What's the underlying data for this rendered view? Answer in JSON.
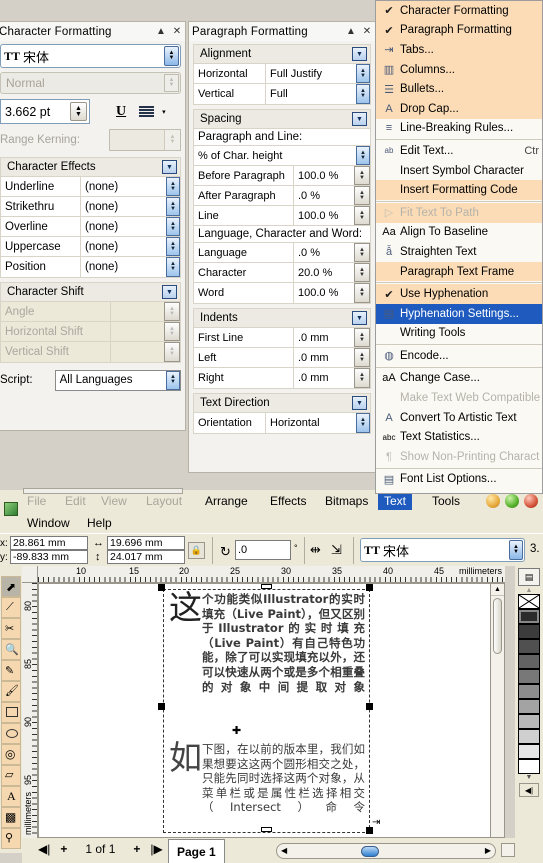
{
  "character_docker": {
    "title": "Character Formatting",
    "collapse_icon": "▲",
    "close_icon": "✕",
    "font": {
      "name": "宋体",
      "icon": "TT"
    },
    "style": {
      "value": "Normal"
    },
    "size": {
      "value": "3.662 pt"
    },
    "underline_icon": "U",
    "align_icon": "align-lines-icon",
    "dropdown_icon": "▾",
    "kerning": {
      "label": "Range Kerning:",
      "value": ""
    },
    "effects_group": {
      "title": "Character Effects",
      "rows": [
        {
          "label": "Underline",
          "value": "(none)"
        },
        {
          "label": "Strikethru",
          "value": "(none)"
        },
        {
          "label": "Overline",
          "value": "(none)"
        },
        {
          "label": "Uppercase",
          "value": "(none)"
        },
        {
          "label": "Position",
          "value": "(none)"
        }
      ]
    },
    "shift_group": {
      "title": "Character Shift",
      "rows": [
        {
          "label": "Angle",
          "value": ""
        },
        {
          "label": "Horizontal Shift",
          "value": ""
        },
        {
          "label": "Vertical Shift",
          "value": ""
        }
      ]
    },
    "script": {
      "label": "Script:",
      "value": "All Languages"
    }
  },
  "paragraph_docker": {
    "title": "Paragraph Formatting",
    "collapse_icon": "▲",
    "close_icon": "✕",
    "alignment": {
      "title": "Alignment",
      "rows": [
        {
          "label": "Horizontal",
          "value": "Full Justify"
        },
        {
          "label": "Vertical",
          "value": "Full"
        }
      ]
    },
    "spacing": {
      "title": "Spacing",
      "section1": "Paragraph and Line:",
      "unit": "% of Char. height",
      "rows1": [
        {
          "label": "Before Paragraph",
          "value": "100.0 %"
        },
        {
          "label": "After Paragraph",
          "value": ".0 %"
        },
        {
          "label": "Line",
          "value": "100.0 %"
        }
      ],
      "section2": "Language, Character and Word:",
      "rows2": [
        {
          "label": "Language",
          "value": ".0 %"
        },
        {
          "label": "Character",
          "value": "20.0 %"
        },
        {
          "label": "Word",
          "value": "100.0 %"
        }
      ]
    },
    "indents": {
      "title": "Indents",
      "rows": [
        {
          "label": "First Line",
          "value": ".0 mm"
        },
        {
          "label": "Left",
          "value": ".0 mm"
        },
        {
          "label": "Right",
          "value": ".0 mm"
        }
      ]
    },
    "text_direction": {
      "title": "Text Direction",
      "rows": [
        {
          "label": "Orientation",
          "value": "Horizontal"
        }
      ]
    }
  },
  "text_menu": {
    "items": [
      {
        "label": "Character Formatting",
        "icon": "check-icon",
        "checked": true,
        "state": "highlight"
      },
      {
        "label": "Paragraph Formatting",
        "icon": "check-icon",
        "checked": true,
        "state": "highlight"
      },
      {
        "label": "Tabs...",
        "icon": "tabs-icon",
        "state": "highlight"
      },
      {
        "label": "Columns...",
        "icon": "columns-icon",
        "state": "highlight"
      },
      {
        "label": "Bullets...",
        "icon": "bullets-icon",
        "state": "highlight"
      },
      {
        "label": "Drop Cap...",
        "icon": "dropcap-icon",
        "state": "highlight"
      },
      {
        "label": "Line-Breaking Rules...",
        "icon": "linebreak-icon",
        "state": "normal"
      },
      {
        "separator": true
      },
      {
        "label": "Edit Text...",
        "icon": "edit-text-icon",
        "state": "normal",
        "shortcut": "Ctr"
      },
      {
        "label": "Insert Symbol Character",
        "icon": "",
        "state": "normal"
      },
      {
        "label": "Insert Formatting Code",
        "icon": "",
        "state": "highlight"
      },
      {
        "separator": true
      },
      {
        "label": "Fit Text To Path",
        "icon": "fit-path-icon",
        "state": "highlight",
        "disabled": true
      },
      {
        "label": "Align To Baseline",
        "icon": "Aa",
        "state": "normal"
      },
      {
        "label": "Straighten Text",
        "icon": "straighten-icon",
        "state": "normal"
      },
      {
        "label": "Paragraph Text Frame",
        "icon": "",
        "state": "highlight"
      },
      {
        "separator": true
      },
      {
        "label": "Use Hyphenation",
        "icon": "check-icon",
        "checked": true,
        "state": "highlight"
      },
      {
        "label": "Hyphenation Settings...",
        "icon": "hyphen-icon",
        "state": "selected"
      },
      {
        "label": "Writing Tools",
        "icon": "",
        "state": "normal"
      },
      {
        "separator": true
      },
      {
        "label": "Encode...",
        "icon": "encode-icon",
        "state": "normal"
      },
      {
        "separator": true
      },
      {
        "label": "Change Case...",
        "icon": "case-icon",
        "state": "normal"
      },
      {
        "label": "Make Text Web Compatible",
        "icon": "",
        "state": "normal",
        "disabled": true
      },
      {
        "label": "Convert To Artistic Text",
        "icon": "artistic-icon",
        "state": "normal"
      },
      {
        "label": "Text Statistics...",
        "icon": "stats-icon",
        "state": "normal"
      },
      {
        "label": "Show Non-Printing Charact",
        "icon": "pilcrow-icon",
        "state": "normal",
        "disabled": true
      },
      {
        "separator": true
      },
      {
        "label": "Font List Options...",
        "icon": "fontlist-icon",
        "state": "normal"
      }
    ]
  },
  "app": {
    "menubar": {
      "row1": [
        "File",
        "Edit",
        "View",
        "Layout",
        "Arrange",
        "Effects",
        "Bitmaps",
        "Text",
        "Tools"
      ],
      "row2": [
        "Window",
        "Help"
      ],
      "active": "Text"
    },
    "window_buttons": [
      "minimize-button",
      "maximize-button",
      "close-button"
    ],
    "property_bar": {
      "x_label": "x:",
      "x_value": "28.861 mm",
      "y_label": "y:",
      "y_value": "-89.833 mm",
      "width_value": "19.696 mm",
      "height_value": "24.017 mm",
      "lock_icon": "lock-ratio-icon",
      "rotation_value": ".0",
      "rotation_unit": "°",
      "mirror_h_icon": "mirror-horizontal-icon",
      "mirror_v_icon": "mirror-vertical-icon",
      "font_icon": "TT",
      "font_name": "宋体",
      "font_size": "3."
    },
    "ruler": {
      "h_ticks": [
        "10",
        "15",
        "20",
        "25",
        "30",
        "35",
        "40",
        "45"
      ],
      "h_unit": "millimeters",
      "v_ticks": [
        "80",
        "85",
        "90",
        "95"
      ],
      "v_unit": "millimeters"
    },
    "canvas": {
      "paragraph1_dropcap": "这",
      "paragraph1": "个功能类似Illustrator的实时填充（Live Paint），但又区别于Illustrator的实时填充（Live Paint）有自己特色功能，除了可以实现填充以外，还可以快速从两个或是多个相重叠的对象中间提取对象",
      "paragraph2_dropcap": "如",
      "paragraph2": "下图，在以前的版本里，我们如果想要这这两个圆形相交之处，只能先同时选择这两个对象，从菜单栏或是属性栏选择相交（Intersect）命令"
    },
    "status_bar": {
      "first_page_icon": "◀|",
      "add_page_left": "+",
      "page_count": "1 of 1",
      "add_page_right": "+",
      "last_page_icon": "|▶",
      "page_tab": "Page 1"
    }
  }
}
